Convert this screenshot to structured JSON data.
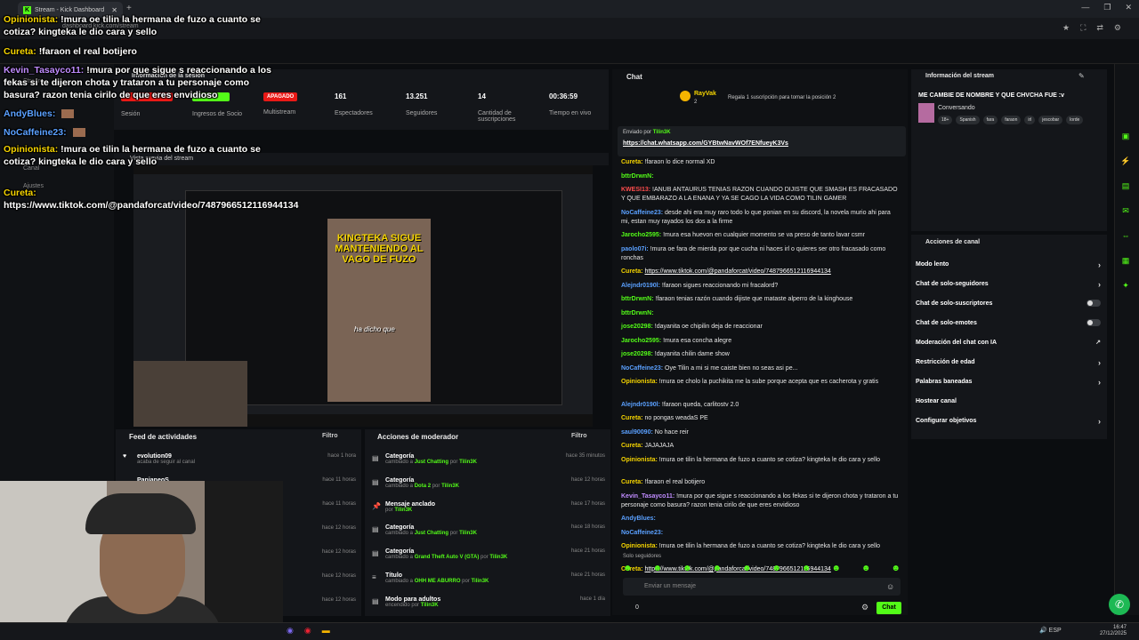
{
  "browser": {
    "tab_title": "Stream - Kick Dashboard",
    "url": "dashboard.kick.com/stream",
    "new_tab": "+",
    "window_controls": [
      "—",
      "❐",
      "✕"
    ],
    "url_icons": [
      "★",
      "⛶",
      "⇄",
      "⚙"
    ]
  },
  "overlay_chat": [
    {
      "user": "Opinionista:",
      "color": "#f5d400",
      "text": "!mura oe tilin la hermana de fuzo a cuanto se cotiza? kingteka le dio cara y sello"
    },
    {
      "user": "Cureta:",
      "color": "#f5d400",
      "text": "!faraon el real botijero"
    },
    {
      "user": "Kevin_Tasayco11:",
      "color": "#c08cff",
      "text": "!mura por que sigue s reaccionando a los fekas si te dijeron chota y trataron a tu personaje como basura? razon tenia cirilo de que eres envidioso"
    },
    {
      "user": "AndyBlues:",
      "color": "#5aa0ff",
      "text": ""
    },
    {
      "user": "NoCaffeine23:",
      "color": "#5aa0ff",
      "text": ""
    },
    {
      "user": "Opinionista:",
      "color": "#f5d400",
      "text": "!mura oe tilin la hermana de fuzo a cuanto se cotiza? kingteka le dio cara y sello"
    },
    {
      "user": "Cureta:",
      "color": "#f5d400",
      "text": "https://www.tiktok.com/@pandaforcat/video/7487966512116944134"
    }
  ],
  "sidebar_left": {
    "items": [
      "Stream",
      "Canal",
      "Ajustes"
    ]
  },
  "session": {
    "title": "Información de la sesión",
    "preview_title": "Vista previa del stream",
    "stats": [
      {
        "value": "",
        "label": "Sesión",
        "badge": "",
        "badge_color": "#e91916"
      },
      {
        "value": "",
        "label": "Ingresos de Socio",
        "badge": "",
        "badge_color": "#53fc18"
      },
      {
        "value": "",
        "label": "Multistream",
        "badge": "APAGADO",
        "badge_color": "#e91916"
      },
      {
        "value": "161",
        "label": "Espectadores",
        "badge": "",
        "badge_color": ""
      },
      {
        "value": "13.251",
        "label": "Seguidores",
        "badge": "",
        "badge_color": ""
      },
      {
        "value": "14",
        "label": "Cantidad de suscripciones",
        "badge": "",
        "badge_color": ""
      },
      {
        "value": "00:36:59",
        "label": "Tiempo en vivo",
        "badge": "",
        "badge_color": ""
      }
    ],
    "video_text": "KINGTEKA SIGUE MANTENIENDO AL VAGO DE FUZO",
    "video_caption": "ha dicho que"
  },
  "activity": {
    "title": "Feed de actividades",
    "filter": "Filtro",
    "rows": [
      {
        "name": "evolution09",
        "sub": "acaba de seguir al canal",
        "time": "hace 1 hora"
      },
      {
        "name": "PanjaneoS",
        "sub": "",
        "time": "hace 11 horas"
      },
      {
        "name": "",
        "sub": "",
        "time": "hace 11 horas"
      },
      {
        "name": "",
        "sub": "",
        "time": "hace 12 horas"
      },
      {
        "name": "",
        "sub": "",
        "time": "hace 12 horas"
      },
      {
        "name": "",
        "sub": "",
        "time": "hace 12 horas"
      },
      {
        "name": "",
        "sub": "",
        "time": "hace 12 horas"
      }
    ]
  },
  "mod_actions": {
    "title": "Acciones de moderador",
    "filter": "Filtro",
    "rows": [
      {
        "icon": "▤",
        "name": "Categoría",
        "pre": "cambiado a",
        "val": "Just Chatting",
        "by": "por",
        "user": "Tilin3K",
        "time": "hace 35 minutos"
      },
      {
        "icon": "▤",
        "name": "Categoría",
        "pre": "cambiado a",
        "val": "Dota 2",
        "by": "por",
        "user": "Tilin3K",
        "time": "hace 12 horas"
      },
      {
        "icon": "📌",
        "name": "Mensaje anclado",
        "pre": "por",
        "val": "Tilin3K",
        "by": "",
        "user": "",
        "time": "hace 17 horas"
      },
      {
        "icon": "▤",
        "name": "Categoría",
        "pre": "cambiado a",
        "val": "Just Chatting",
        "by": "por",
        "user": "Tilin3K",
        "time": "hace 18 horas"
      },
      {
        "icon": "▤",
        "name": "Categoría",
        "pre": "cambiado a",
        "val": "Grand Theft Auto V (GTA)",
        "by": "por",
        "user": "Tilin3K",
        "time": "hace 21 horas"
      },
      {
        "icon": "≡",
        "name": "Título",
        "pre": "cambiado a",
        "val": "OHH ME ABURRO",
        "by": "por",
        "user": "Tilin3K",
        "time": "hace 21 horas"
      },
      {
        "icon": "▤",
        "name": "Modo para adultos",
        "pre": "encendido por",
        "val": "Tilin3K",
        "by": "",
        "user": "",
        "time": "hace 1 día"
      }
    ]
  },
  "chat": {
    "title": "Chat",
    "sub_user": "RayVak",
    "sub_count": "2",
    "sub_text": "Regala 1 suscripción para tomar la posición 2",
    "pinned_by_label": "Enviado por",
    "pinned_by": "Tilin3K",
    "pinned_link": "https://chat.whatsapp.com/GYBtwNavWOf7ENfueyK3Vs",
    "messages": [
      {
        "user": "Cureta:",
        "color": "#f5d400",
        "text": "!faraon lo dice normal XD",
        "link": false
      },
      {
        "user": "bttrDrwnN:",
        "color": "#53fc18",
        "text": "",
        "link": false
      },
      {
        "user": "KWESI13:",
        "color": "#ff4d4d",
        "text": "!ANUB ANTAURUS TENIAS RAZON CUANDO DIJISTE QUE SMASH ES FRACASADO Y QUE EMBARAZO A LA ENANA Y YA SE CAGO LA VIDA COMO TILIN GAMER",
        "link": false
      },
      {
        "user": "NoCaffeine23:",
        "color": "#5aa0ff",
        "text": "desde ahi era muy raro todo lo que ponian en su discord, la novela murio ahi para mi, estan muy rayados los dos a la firme",
        "link": false
      },
      {
        "user": "Jarocho2595:",
        "color": "#53fc18",
        "text": "!mura esa huevon en cualquier momento se va preso de tanto lavar csmr",
        "link": false
      },
      {
        "user": "paolo07i:",
        "color": "#5aa0ff",
        "text": "!mura oe fara de mierda por que cucha ni haces irl o quieres ser otro fracasado como ronchas",
        "link": false
      },
      {
        "user": "Cureta:",
        "color": "#f5d400",
        "text": "https://www.tiktok.com/@pandaforcat/video/7487966512116944134",
        "link": true
      },
      {
        "user": "Alejndr0190l:",
        "color": "#5aa0ff",
        "text": "!faraon sigues reaccionando mi fracalord?",
        "link": false
      },
      {
        "user": "bttrDrwnN:",
        "color": "#53fc18",
        "text": "!faraon tenias razón cuando dijiste que mataste alperro de la kinghouse",
        "link": false
      },
      {
        "user": "bttrDrwnN:",
        "color": "#53fc18",
        "text": "",
        "link": false
      },
      {
        "user": "jose20298:",
        "color": "#53fc18",
        "text": "!dayanita oe chipilin deja de reaccionar",
        "link": false
      },
      {
        "user": "Jarocho2595:",
        "color": "#53fc18",
        "text": "!mura esa concha alegre",
        "link": false
      },
      {
        "user": "jose20298:",
        "color": "#53fc18",
        "text": "!dayanita chilin dame show",
        "link": false
      },
      {
        "user": "NoCaffeine23:",
        "color": "#5aa0ff",
        "text": "Oye Tilin a mi si me caiste bien no seas asi pe...",
        "link": false
      },
      {
        "user": "Opinionista:",
        "color": "#f5d400",
        "text": "!mura oe cholo la puchikita me la sube porque acepta que es cacherota y gratis",
        "link": false
      },
      {
        "user": "Alejndr0190l:",
        "color": "#5aa0ff",
        "text": "!faraon queda, carlitostv 2.0",
        "link": false
      },
      {
        "user": "Cureta:",
        "color": "#f5d400",
        "text": "no pongas weadaS PE",
        "link": false
      },
      {
        "user": "saul90090:",
        "color": "#5aa0ff",
        "text": "No hace reir",
        "link": false
      },
      {
        "user": "Cureta:",
        "color": "#f5d400",
        "text": "JAJAJAJA",
        "link": false
      },
      {
        "user": "Opinionista:",
        "color": "#f5d400",
        "text": "!mura oe tilin la hermana de fuzo a cuanto se cotiza? kingteka le dio cara y sello",
        "link": false
      },
      {
        "user": "Cureta:",
        "color": "#f5d400",
        "text": "!faraon el real botijero",
        "link": false
      },
      {
        "user": "Kevin_Tasayco11:",
        "color": "#c08cff",
        "text": "!mura por que sigue s reaccionando a los fekas si te dijeron chota y trataron a tu personaje como basura? razon tenia cirilo de que eres envidioso",
        "link": false
      },
      {
        "user": "AndyBlues:",
        "color": "#5aa0ff",
        "text": "",
        "link": false
      },
      {
        "user": "NoCaffeine23:",
        "color": "#5aa0ff",
        "text": "",
        "link": false
      },
      {
        "user": "Opinionista:",
        "color": "#f5d400",
        "text": "!mura oe tilin la hermana de fuzo a cuanto se cotiza? kingteka le dio cara y sello",
        "link": false
      },
      {
        "user": "Cureta:",
        "color": "#f5d400",
        "text": "https://www.tiktok.com/@pandaforcat/video/7487966512116944134",
        "link": true
      }
    ],
    "solo_label": "Solo seguidores",
    "input_placeholder": "Enviar un mensaje",
    "send_label": "Chat",
    "count": "0"
  },
  "stream_info": {
    "title": "Información del stream",
    "stream_title": "ME CAMBIE DE NOMBRE Y QUE CHVCHA FUE :v",
    "category": "Conversando",
    "tags": [
      "18+",
      "Spanish",
      "fara",
      "faraon",
      "irl",
      "jescobar",
      "lorde"
    ]
  },
  "channel_actions": {
    "title": "Acciones de canal",
    "items": [
      {
        "label": "Modo lento",
        "type": "arrow"
      },
      {
        "label": "Chat de solo-seguidores",
        "type": "arrow"
      },
      {
        "label": "Chat de solo-suscriptores",
        "type": "toggle"
      },
      {
        "label": "Chat de solo-emotes",
        "type": "toggle"
      },
      {
        "label": "Moderación del chat con IA",
        "type": "ext"
      },
      {
        "label": "Restricción de edad",
        "type": "arrow"
      },
      {
        "label": "Palabras baneadas",
        "type": "arrow"
      },
      {
        "label": "Hostear canal",
        "type": "none"
      },
      {
        "label": "Configurar objetivos",
        "type": "arrow"
      }
    ]
  },
  "taskbar": {
    "lang": "ESP",
    "time": "16:47",
    "date": "27/12/2025"
  },
  "colors": {
    "accent": "#53fc18",
    "danger": "#e91916"
  }
}
